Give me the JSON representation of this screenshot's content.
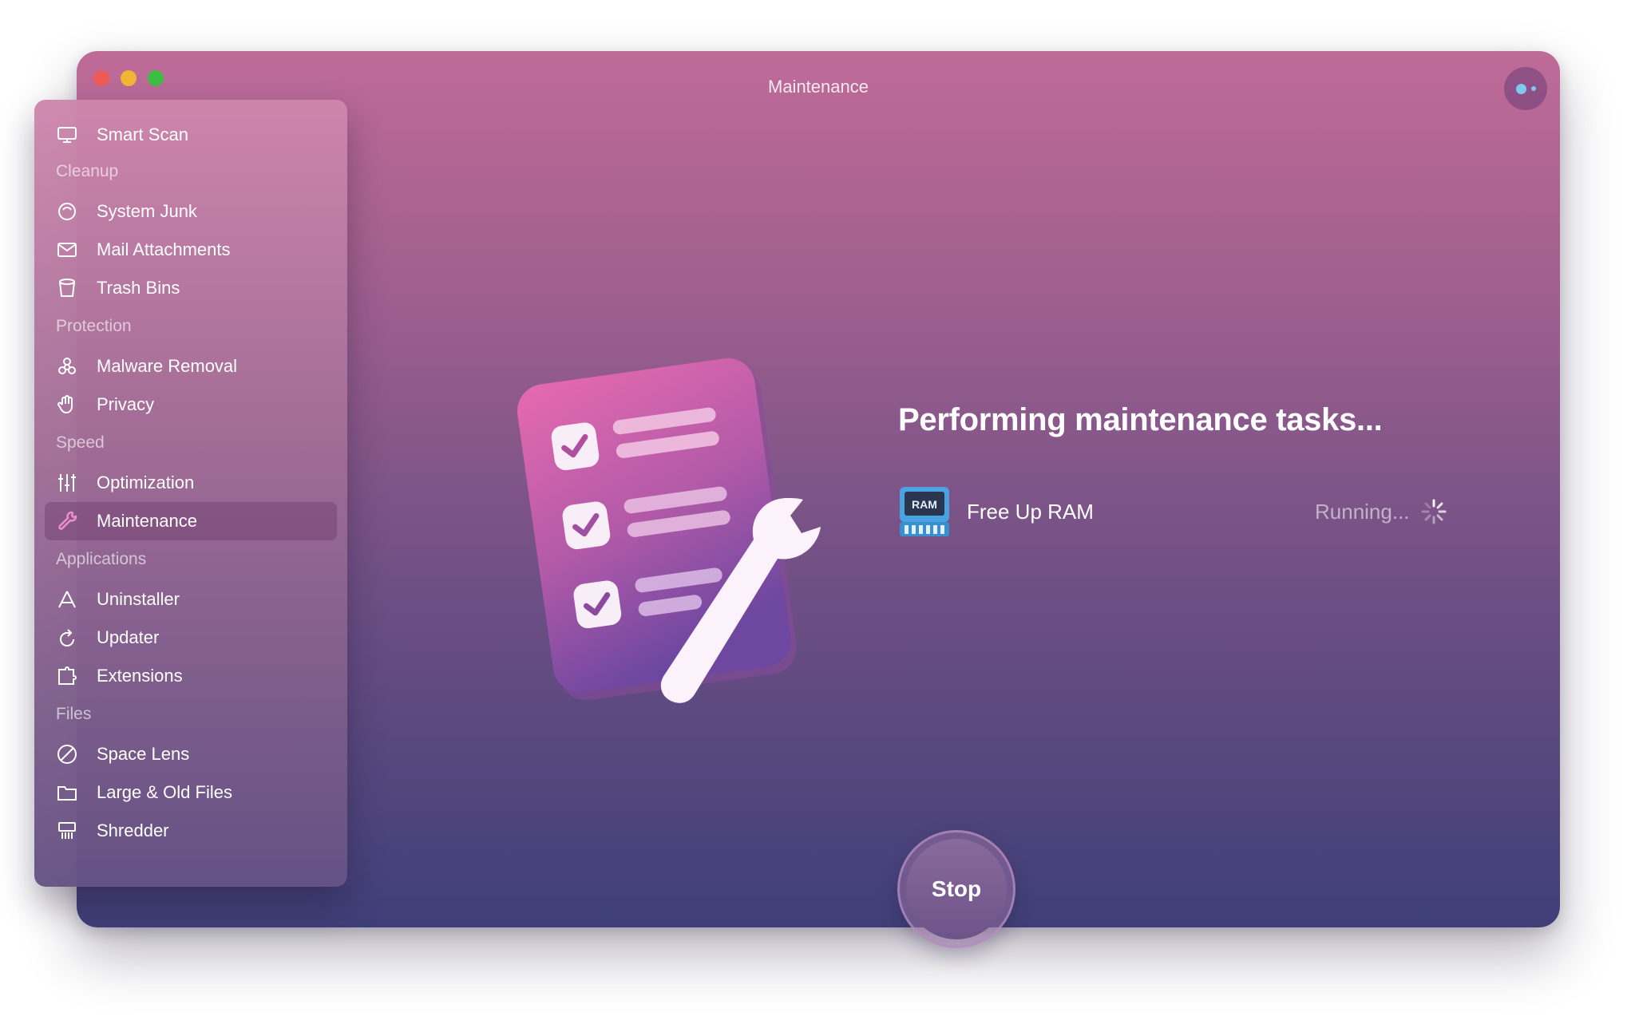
{
  "window": {
    "title": "Maintenance"
  },
  "sidebar": {
    "top_item": {
      "label": "Smart Scan",
      "icon": "monitor-icon"
    },
    "sections": [
      {
        "title": "Cleanup",
        "items": [
          {
            "label": "System Junk",
            "icon": "junk-icon"
          },
          {
            "label": "Mail Attachments",
            "icon": "mail-icon"
          },
          {
            "label": "Trash Bins",
            "icon": "trash-icon"
          }
        ]
      },
      {
        "title": "Protection",
        "items": [
          {
            "label": "Malware Removal",
            "icon": "biohazard-icon"
          },
          {
            "label": "Privacy",
            "icon": "hand-icon"
          }
        ]
      },
      {
        "title": "Speed",
        "items": [
          {
            "label": "Optimization",
            "icon": "sliders-icon"
          },
          {
            "label": "Maintenance",
            "icon": "wrench-icon",
            "active": true
          }
        ]
      },
      {
        "title": "Applications",
        "items": [
          {
            "label": "Uninstaller",
            "icon": "uninstaller-icon"
          },
          {
            "label": "Updater",
            "icon": "updater-icon"
          },
          {
            "label": "Extensions",
            "icon": "extensions-icon"
          }
        ]
      },
      {
        "title": "Files",
        "items": [
          {
            "label": "Space Lens",
            "icon": "lens-icon"
          },
          {
            "label": "Large & Old Files",
            "icon": "folder-icon"
          },
          {
            "label": "Shredder",
            "icon": "shredder-icon"
          }
        ]
      }
    ]
  },
  "main": {
    "headline": "Performing maintenance tasks...",
    "task": {
      "name": "Free Up RAM",
      "status": "Running...",
      "icon_label": "RAM"
    },
    "stop_label": "Stop"
  },
  "colors": {
    "accent_pink": "#d46aa6",
    "bg_bottom": "#3f3f78",
    "ram_icon_blue": "#4aa3e0"
  }
}
